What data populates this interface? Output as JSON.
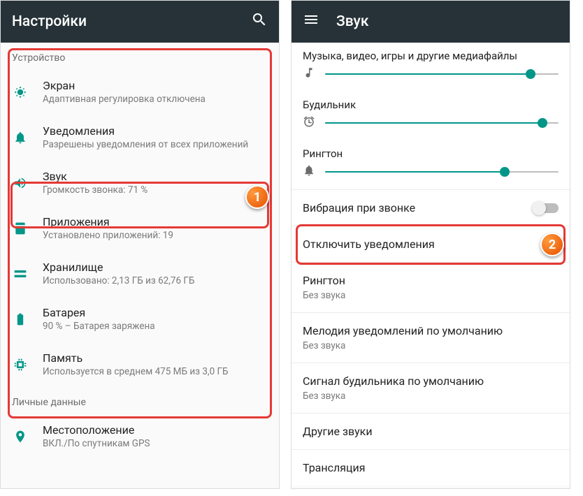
{
  "colors": {
    "accent": "#009688",
    "appbar": "#263238",
    "highlight": "#e53935",
    "badge": "#e65100"
  },
  "left": {
    "appbar_title": "Настройки",
    "section_device": "Устройство",
    "section_personal": "Личные данные",
    "rows": {
      "display": {
        "title": "Экран",
        "sub": "Адаптивная регулировка отключена"
      },
      "notif": {
        "title": "Уведомления",
        "sub": "Разрешены уведомления от всех приложений"
      },
      "sound": {
        "title": "Звук",
        "sub": "Громкость звонка: 71 %"
      },
      "apps": {
        "title": "Приложения",
        "sub": "Установлено приложений: 19"
      },
      "storage": {
        "title": "Хранилище",
        "sub": "Использовано: 2,13 ГБ из 62,76 ГБ"
      },
      "battery": {
        "title": "Батарея",
        "sub": "90 % – Батарея заряжена"
      },
      "memory": {
        "title": "Память",
        "sub": "Используется в среднем 475 МБ из 3,0 ГБ"
      },
      "location": {
        "title": "Местоположение",
        "sub": "ВКЛ./По спутникам GPS"
      }
    },
    "step_badge": "1"
  },
  "right": {
    "appbar_title": "Звук",
    "sliders": {
      "media": {
        "label": "Музыка, видео, игры и другие медиафайлы",
        "percent": 88
      },
      "alarm": {
        "label": "Будильник",
        "percent": 93
      },
      "ring": {
        "label": "Рингтон",
        "percent": 77
      }
    },
    "rows": {
      "vibrate": {
        "title": "Вибрация при звонке"
      },
      "disable": {
        "title": "Отключить уведомления"
      },
      "ringtone": {
        "title": "Рингтон",
        "sub": "Без звука"
      },
      "notifmel": {
        "title": "Мелодия уведомлений по умолчанию",
        "sub": "Без звука"
      },
      "alarmsig": {
        "title": "Сигнал будильника по умолчанию",
        "sub": "Без звука"
      },
      "other": {
        "title": "Другие звуки"
      },
      "cast": {
        "title": "Трансляция"
      }
    },
    "step_badge": "2"
  }
}
